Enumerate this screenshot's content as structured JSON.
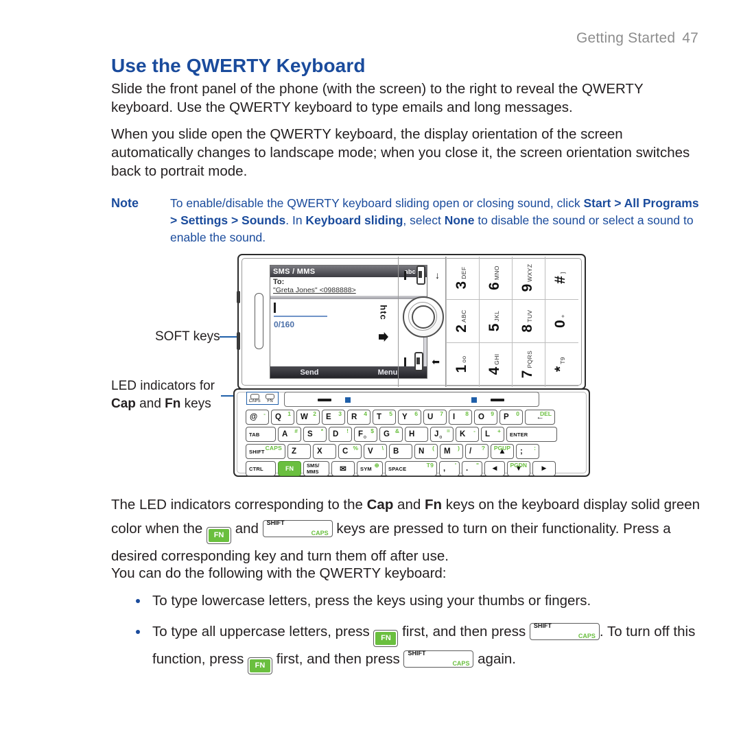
{
  "header": {
    "section": "Getting Started",
    "page_number": "47"
  },
  "heading": "Use the QWERTY Keyboard",
  "paragraphs": {
    "p1": "Slide the front panel of the phone (with the screen) to the right to reveal the QWERTY keyboard. Use the QWERTY keyboard to type emails and long messages.",
    "p2": "When you slide open the QWERTY keyboard, the display orientation of the screen automatically changes to landscape mode; when you close it, the screen orientation switches back to portrait mode."
  },
  "note": {
    "label": "Note",
    "t1": "To enable/disable the QWERTY keyboard sliding open or closing sound, click ",
    "b1": "Start > All Programs > Settings > Sounds",
    "t2": ". In ",
    "b2": "Keyboard sliding",
    "t3": ", select ",
    "b3": "None",
    "t4": " to disable the sound or select a sound to enable the sound."
  },
  "callouts": {
    "soft_keys": "SOFT keys",
    "led_line1": "LED indicators for",
    "led_cap": "Cap",
    "led_and": " and ",
    "led_fn": "Fn",
    "led_keys": " keys"
  },
  "phone": {
    "screen": {
      "title": "SMS / MMS",
      "input_mode": "abc",
      "signal_icon": "signal-bars-icon",
      "to_label": "To:",
      "recipient": "\"Greta Jones\" <0988888>",
      "char_count": "0/160",
      "softkey_left": "Send",
      "softkey_right": "Menu"
    },
    "brand": "htc",
    "keypad": [
      {
        "num": "1",
        "sub": "oo"
      },
      {
        "num": "2",
        "sub": "ABC"
      },
      {
        "num": "3",
        "sub": "DEF"
      },
      {
        "num": "4",
        "sub": "GHI"
      },
      {
        "num": "5",
        "sub": "JKL"
      },
      {
        "num": "6",
        "sub": "MNO"
      },
      {
        "num": "7",
        "sub": "PQRS"
      },
      {
        "num": "8",
        "sub": "TUV"
      },
      {
        "num": "9",
        "sub": "WXYZ"
      },
      {
        "num": "*",
        "sub": "T9"
      },
      {
        "num": "0",
        "sub": "+"
      },
      {
        "num": "#",
        "sub": "]"
      }
    ],
    "leds": [
      {
        "label": "CAPS"
      },
      {
        "label": "FN"
      }
    ],
    "keyboard": {
      "row1": [
        {
          "main": "@",
          "alt": "-",
          "dark": false
        },
        {
          "main": "Q",
          "alt": "1"
        },
        {
          "main": "W",
          "alt": "2"
        },
        {
          "main": "E",
          "alt": "3"
        },
        {
          "main": "R",
          "alt": "4"
        },
        {
          "main": "T",
          "alt": "5"
        },
        {
          "main": "Y",
          "alt": "6"
        },
        {
          "main": "U",
          "alt": "7"
        },
        {
          "main": "I",
          "alt": "8"
        },
        {
          "main": "O",
          "alt": "9"
        },
        {
          "main": "P",
          "alt": "0"
        },
        {
          "main": "←",
          "alt": "DEL"
        }
      ],
      "row2": [
        {
          "main": "TAB",
          "alt": ""
        },
        {
          "main": "A",
          "alt": "#"
        },
        {
          "main": "S",
          "alt": "*"
        },
        {
          "main": "D",
          "alt": "!"
        },
        {
          "main": "F",
          "sub": "o",
          "alt": "$"
        },
        {
          "main": "G",
          "alt": "&"
        },
        {
          "main": "H",
          "alt": ""
        },
        {
          "main": "J",
          "sub": "o",
          "alt": "="
        },
        {
          "main": "K",
          "alt": "-"
        },
        {
          "main": "L",
          "alt": "+"
        },
        {
          "main": "ENTER",
          "alt": ""
        }
      ],
      "row3": [
        {
          "main": "SHIFT",
          "alt": "CAPS"
        },
        {
          "main": "Z",
          "alt": ""
        },
        {
          "main": "X",
          "alt": ""
        },
        {
          "main": "C",
          "alt": "%"
        },
        {
          "main": "V",
          "alt": "\\"
        },
        {
          "main": "B",
          "alt": ""
        },
        {
          "main": "N",
          "alt": "("
        },
        {
          "main": "M",
          "alt": ")"
        },
        {
          "main": "/",
          "alt": "?"
        },
        {
          "main": "▲",
          "alt": "PGUP"
        },
        {
          "main": ";",
          "alt": ":"
        }
      ],
      "row4": [
        {
          "main": "CTRL",
          "alt": ""
        },
        {
          "main": "FN",
          "alt": ""
        },
        {
          "main": "SMS/ MMS",
          "alt": ""
        },
        {
          "main": "✉",
          "alt": ""
        },
        {
          "main": "SYM",
          "alt": "globe-icon"
        },
        {
          "main": "SPACE",
          "alt": "T9"
        },
        {
          "main": ",",
          "alt": "'"
        },
        {
          "main": ".",
          "alt": "\""
        },
        {
          "main": "◄",
          "alt": ""
        },
        {
          "main": "▼",
          "alt": "PGDN"
        },
        {
          "main": "►",
          "alt": ""
        }
      ]
    }
  },
  "body_lower": {
    "l1a": "The LED indicators corresponding to the ",
    "l1b": "Cap",
    "l1c": " and ",
    "l1d": "Fn",
    "l1e": " keys on the keyboard display solid green color when the ",
    "l1f": " and ",
    "l1g": " keys are pressed to turn on their functionality. Press a desired corresponding key and turn them off after use.",
    "l2": "You can do the following with the QWERTY keyboard:",
    "bullet1": "To type lowercase letters, press the keys using your thumbs or fingers.",
    "bullet2a": "To type all uppercase letters, press ",
    "bullet2b": " first, and then press ",
    "bullet2c": ".",
    "bullet2d": "To turn off this function, press ",
    "bullet2e": " first, and then press ",
    "bullet2f": " again."
  },
  "inline_keys": {
    "fn": "FN",
    "shift": "SHIFT",
    "caps": "CAPS"
  },
  "colors": {
    "heading_blue": "#1a4b9c",
    "note_blue": "#1a4b9c",
    "green": "#6abf3f",
    "header_gray": "#8d8d8d"
  }
}
